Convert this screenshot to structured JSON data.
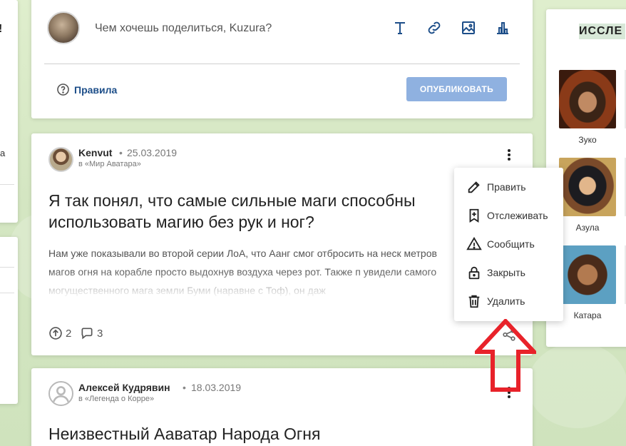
{
  "composer": {
    "prompt": "Чем хочешь поделиться, Kuzura?",
    "tools": [
      "text-icon",
      "link-icon",
      "image-icon",
      "poll-icon"
    ],
    "rules_label": "Правила",
    "publish_label": "ОПУБЛИКОВАТЬ"
  },
  "left": {
    "fragment_top": "!",
    "fragment_mid": "а"
  },
  "posts": [
    {
      "author": "Kenvut",
      "date": "25.03.2019",
      "community": "в «Мир Аватара»",
      "title": "Я так понял, что самые сильные маги способны использовать магию без рук и ног?",
      "body": "Нам уже показывали во второй серии ЛоА, что Аанг смог отбросить на неск метров магов огня на корабле просто выдохнув воздуха через рот. Также п увидели самого могущественного мага земли Буми (наравне с Тоф), он даж",
      "upvotes": "2",
      "comments": "3"
    },
    {
      "author": "Алексей Кудрявин",
      "date": "18.03.2019",
      "community": "в «Легенда о Корре»",
      "title": "Неизвестный Ааватар Народа Огня"
    }
  ],
  "menu": {
    "items": [
      {
        "label": "Править",
        "icon": "pencil-icon"
      },
      {
        "label": "Отслеживать",
        "icon": "follow-icon"
      },
      {
        "label": "Сообщить",
        "icon": "warning-icon"
      },
      {
        "label": "Закрыть",
        "icon": "lock-icon"
      },
      {
        "label": "Удалить",
        "icon": "trash-icon"
      }
    ]
  },
  "sidebar": {
    "title": "ИССЛЕ",
    "characters": [
      {
        "name": "Зуко"
      },
      {
        "name": "Азула"
      },
      {
        "name": "Катара"
      }
    ]
  },
  "colors": {
    "accent": "#1d4e89",
    "publish": "#8fb1e0",
    "arrow": "#e8222a",
    "background": "#d8e9c8"
  }
}
